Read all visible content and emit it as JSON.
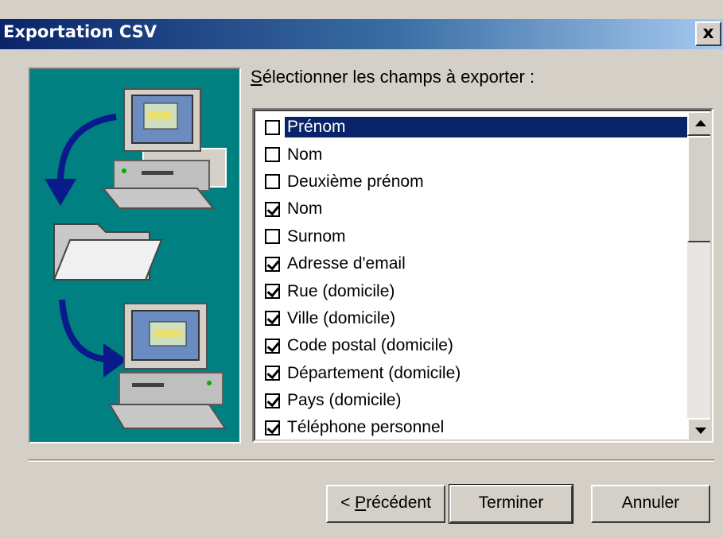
{
  "window": {
    "title": "Exportation CSV",
    "close_label": "x"
  },
  "fields_label": {
    "mnemonic": "S",
    "rest": "électionner les champs à exporter :"
  },
  "fields": [
    {
      "label": "Prénom",
      "checked": false,
      "selected": true
    },
    {
      "label": "Nom",
      "checked": false,
      "selected": false
    },
    {
      "label": "Deuxième prénom",
      "checked": false,
      "selected": false
    },
    {
      "label": "Nom",
      "checked": true,
      "selected": false
    },
    {
      "label": "Surnom",
      "checked": false,
      "selected": false
    },
    {
      "label": "Adresse d'email",
      "checked": true,
      "selected": false
    },
    {
      "label": "Rue (domicile)",
      "checked": true,
      "selected": false
    },
    {
      "label": "Ville (domicile)",
      "checked": true,
      "selected": false
    },
    {
      "label": "Code postal (domicile)",
      "checked": true,
      "selected": false
    },
    {
      "label": "Département (domicile)",
      "checked": true,
      "selected": false
    },
    {
      "label": "Pays (domicile)",
      "checked": true,
      "selected": false
    },
    {
      "label": "Téléphone personnel",
      "checked": true,
      "selected": false
    }
  ],
  "buttons": {
    "prev_prefix": "< ",
    "prev_mnemonic": "P",
    "prev_rest": "récédent",
    "finish": "Terminer",
    "cancel": "Annuler"
  },
  "colors": {
    "titlebar_start": "#0a246a",
    "titlebar_end": "#a6caf0",
    "illustration_bg": "#008080",
    "selection": "#0a246a",
    "dialog_bg": "#d4d0c8"
  },
  "icons": [
    "computer-source-icon",
    "folder-icon",
    "computer-destination-icon",
    "arrow-down-icon",
    "arrow-curve-icon"
  ]
}
